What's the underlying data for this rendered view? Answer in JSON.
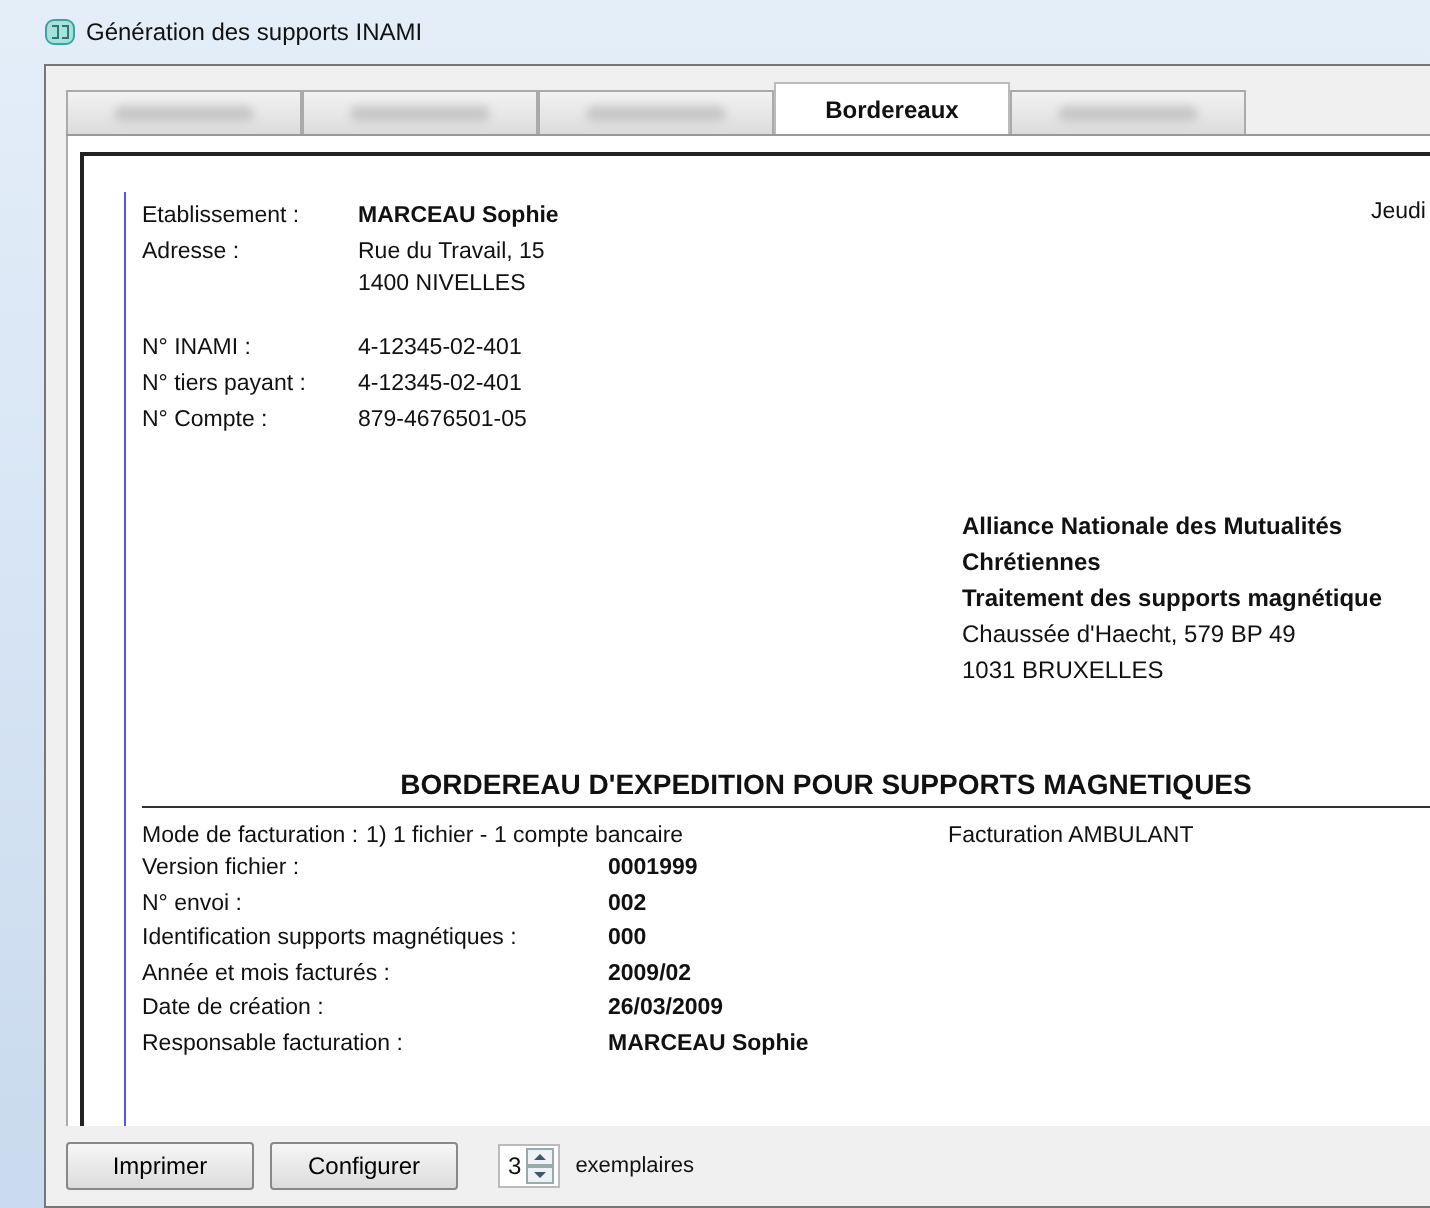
{
  "window": {
    "title": "Génération des supports INAMI"
  },
  "tabs": [
    {
      "selected": false
    },
    {
      "selected": false
    },
    {
      "selected": false
    },
    {
      "label": "Bordereaux",
      "selected": true
    },
    {
      "selected": false
    }
  ],
  "document": {
    "day": "Jeudi",
    "sender": [
      {
        "label": "Etablissement :",
        "value": [
          "MARCEAU Sophie"
        ],
        "bold": true
      },
      {
        "label": "Adresse :",
        "value": [
          "Rue du Travail, 15",
          "1400 NIVELLES"
        ],
        "bold": false
      }
    ],
    "ids": [
      {
        "label": "N° INAMI :",
        "value": "4-12345-02-401"
      },
      {
        "label": "N° tiers payant :",
        "value": "4-12345-02-401"
      },
      {
        "label": "N° Compte :",
        "value": "879-4676501-05"
      }
    ],
    "recipient": [
      {
        "text": "Alliance Nationale des Mutualités",
        "bold": true
      },
      {
        "text": "Chrétiennes",
        "bold": true
      },
      {
        "text": "Traitement des supports magnétique",
        "bold": true
      },
      {
        "text": "Chaussée d'Haecht, 579 BP 49",
        "bold": false
      },
      {
        "text": "1031  BRUXELLES",
        "bold": false
      }
    ],
    "heading": "BORDEREAU D'EXPEDITION POUR SUPPORTS MAGNETIQUES",
    "mode": {
      "label": "Mode de facturation :",
      "value": "1) 1 fichier - 1 compte bancaire",
      "extra": "Facturation AMBULANT"
    },
    "details": [
      {
        "label": "Version fichier :",
        "value": "0001999"
      },
      {
        "label": "N° envoi :",
        "value": "002"
      },
      {
        "label": "Identification supports magnétiques :",
        "value": "000"
      },
      {
        "label": "Année et mois facturés :",
        "value": "2009/02"
      },
      {
        "label": "Date de création :",
        "value": "26/03/2009"
      },
      {
        "label": "Responsable facturation :",
        "value": "MARCEAU Sophie"
      }
    ]
  },
  "footer": {
    "buttons": [
      "Imprimer",
      "Configurer"
    ],
    "copies": "3",
    "copies_label": "exemplaires"
  }
}
